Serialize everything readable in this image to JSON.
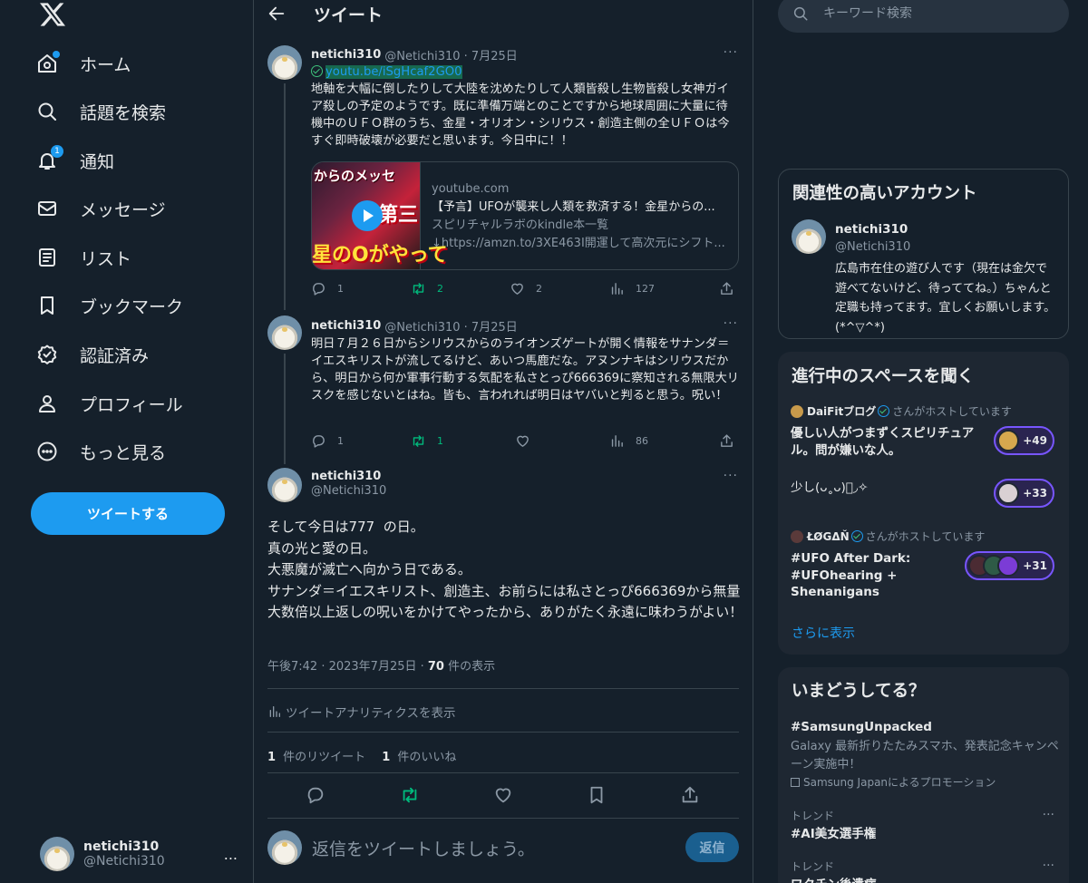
{
  "nav": {
    "items": [
      {
        "label": "ホーム",
        "icon": "home-icon"
      },
      {
        "label": "話題を検索",
        "icon": "search-icon"
      },
      {
        "label": "通知",
        "icon": "bell-icon",
        "badge": "1"
      },
      {
        "label": "メッセージ",
        "icon": "mail-icon"
      },
      {
        "label": "リスト",
        "icon": "list-icon"
      },
      {
        "label": "ブックマーク",
        "icon": "bookmark-icon"
      },
      {
        "label": "認証済み",
        "icon": "verified-icon"
      },
      {
        "label": "プロフィール",
        "icon": "profile-icon"
      },
      {
        "label": "もっと見る",
        "icon": "more-circle-icon"
      }
    ],
    "tweet_button": "ツイートする",
    "account": {
      "name": "netichi310",
      "handle": "@Netichi310",
      "more": "..."
    }
  },
  "header": {
    "title": "ツイート"
  },
  "tweets": [
    {
      "name": "netichi310",
      "meta": "@Netichi310 · 7月25日",
      "link": "youtu.be/iSgHcaf2GO0",
      "text": "地軸を大幅に倒したりして大陸を沈めたりして人類皆殺し生物皆殺し女神ガイア殺しの予定のようです。既に準備万端とのことですから地球周囲に大量に待機中のＵＦＯ群のうち、金星・オリオン・シリウス・創造主側の全ＵＦＯは今すぐ即時破壊が必要だと思います。今日中に！！",
      "card": {
        "thumb_line1": "からのメッセ",
        "thumb_line2": "第三",
        "thumb_line3": "星のOがやって",
        "domain": "youtube.com",
        "title": "【予言】UFOが襲来し人類を救済する！金星からの...",
        "desc1": "スピリチャルラボのkindle本一覧",
        "desc2": "↓https://amzn.to/3XE463I開運して高次元にシフト..."
      },
      "replies": "1",
      "retweets": "2",
      "likes": "2",
      "views": "127"
    },
    {
      "name": "netichi310",
      "meta": "@Netichi310 · 7月25日",
      "text": "明日７月２６日からシリウスからのライオンズゲートが開く情報をサナンダ＝イエスキリストが流してるけど、あいつ馬鹿だな。アヌンナキはシリウスだから、明日から何か軍事行動する気配を私さとっぴ666369に察知される無限大リスクを感じないとはね。皆も、言われれば明日はヤバいと判ると思う。呪い！",
      "replies": "1",
      "retweets": "1",
      "likes": "",
      "views": "86"
    }
  ],
  "focus": {
    "name": "netichi310",
    "handle": "@Netichi310",
    "text": "そして今日は777  の日。\n真の光と愛の日。\n大悪魔が滅亡へ向かう日である。\nサナンダ＝イエスキリスト、創造主、お前らには私さとっぴ666369から無量大数倍以上返しの呪いをかけてやったから、ありがたく永遠に味わうがよい！",
    "time": "午後7:42 · 2023年7月25日 · ",
    "views_num": "70",
    "views_label": " 件の表示",
    "analytics": "ツイートアナリティクスを表示",
    "retweets_num": "1",
    "retweets_label": " 件のリツイート",
    "likes_num": "1",
    "likes_label": " 件のいいね"
  },
  "reply": {
    "placeholder": "返信をツイートしましょう。",
    "button": "返信"
  },
  "search": {
    "placeholder": "キーワード検索"
  },
  "related": {
    "title": "関連性の高いアカウント",
    "name": "netichi310",
    "handle": "@Netichi310",
    "bio": "広島市在住の遊び人です（現在は金欠で遊べてないけど、待っててね。）ちゃんと定職も持ってます。宜しくお願いします。(*^▽^*)"
  },
  "spaces": {
    "title": "進行中のスペースを聞く",
    "items": [
      {
        "host": "DaiFitブログ",
        "host_suffix": "さんがホストしています",
        "title": "優しい人がつまずくスピリチュアル。問が嫌いな人。",
        "count": "+49"
      },
      {
        "host": "",
        "host_suffix": "",
        "title": "少し(ᴗ˳ᴗ)ﾟ◞✧",
        "count": "+33"
      },
      {
        "host": "ŁØGΔŇ",
        "host_suffix": "さんがホストしています",
        "title": "#UFO After Dark: #UFOhearing + Shenanigans",
        "count": "+31"
      }
    ],
    "show_more": "さらに表示"
  },
  "trends": {
    "title": "いまどうしてる？",
    "items": [
      {
        "title": "#SamsungUnpacked",
        "desc": "Galaxy 最新折りたたみスマホ、発表記念キャンペーン実施中！",
        "promo": "Samsung Japanによるプロモーション"
      },
      {
        "sub": "トレンド",
        "title": "#AI美女選手権"
      },
      {
        "sub": "トレンド",
        "title": "ワクチン後遺症"
      }
    ]
  },
  "colors": {
    "background": "#15202b",
    "accent": "#1d9bf0",
    "retweet_green": "#00ba7c",
    "border": "#38444d",
    "muted": "#8b98a5",
    "spaces_purple": "#7856ff"
  }
}
